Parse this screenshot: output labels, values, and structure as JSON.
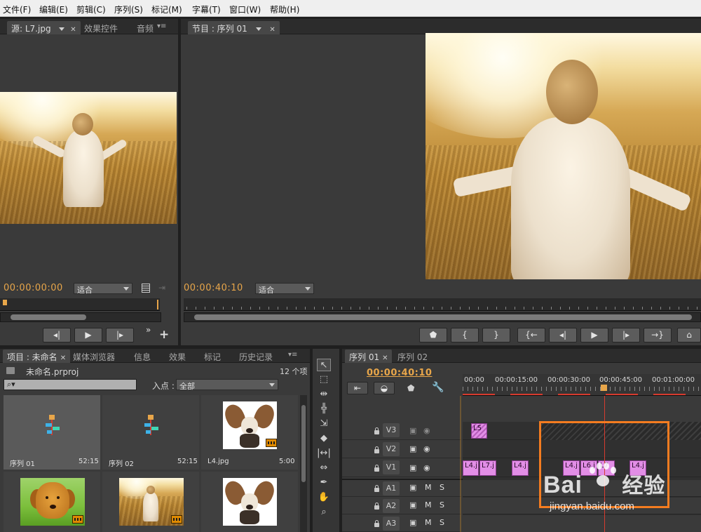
{
  "menu": [
    "文件(F)",
    "编辑(E)",
    "剪辑(C)",
    "序列(S)",
    "标记(M)",
    "字幕(T)",
    "窗口(W)",
    "帮助(H)"
  ],
  "source_panel": {
    "tab_source": "源: L7.jpg",
    "tab_effects": "效果控件",
    "tab_audio": "音频",
    "timecode": "00:00:00:00",
    "fit": "适合",
    "add_symbol": "+",
    "more_symbol": "»"
  },
  "program_panel": {
    "tab": "节目 : 序列 01",
    "timecode": "00:00:40:10",
    "fit": "适合"
  },
  "project_panel": {
    "tabs": [
      "项目 : 未命名",
      "媒体浏览器",
      "信息",
      "效果",
      "标记",
      "历史记录"
    ],
    "project_file": "未命名.prproj",
    "item_count": "12 个项",
    "in_point_label": "入点 :",
    "in_point_value": "全部",
    "items": [
      {
        "name": "序列 01",
        "duration": "52:15",
        "kind": "sequence"
      },
      {
        "name": "序列 02",
        "duration": "52:15",
        "kind": "sequence"
      },
      {
        "name": "L4.jpg",
        "duration": "5:00",
        "kind": "dog"
      },
      {
        "name": "",
        "duration": "",
        "kind": "golden"
      },
      {
        "name": "",
        "duration": "",
        "kind": "field"
      },
      {
        "name": "",
        "duration": "",
        "kind": "dog"
      }
    ]
  },
  "timeline": {
    "tabs": [
      "序列 01",
      "序列 02"
    ],
    "timecode": "00:00:40:10",
    "ruler_labels": [
      "00:00",
      "00:00:15:00",
      "00:00:30:00",
      "00:00:45:00",
      "00:01:00:00"
    ],
    "tracks_video": [
      "V3",
      "V2",
      "V1"
    ],
    "tracks_audio": [
      "A1",
      "A2",
      "A3"
    ],
    "mute_label": "M",
    "solo_label": "S",
    "clips_v3": [
      "L5"
    ],
    "clips_v1": [
      "L4.j",
      "L7.j",
      "L4.j",
      "L4.j",
      "L6.j",
      "L7",
      "L4.j"
    ]
  },
  "watermark": {
    "brand": "Bai",
    "brand2": "经验",
    "url": "jingyan.baidu.com"
  },
  "colors": {
    "timecode": "#e8a64a",
    "clip": "#e28ee6",
    "highlight_box": "#f47c20",
    "playhead": "#d63b2f"
  }
}
